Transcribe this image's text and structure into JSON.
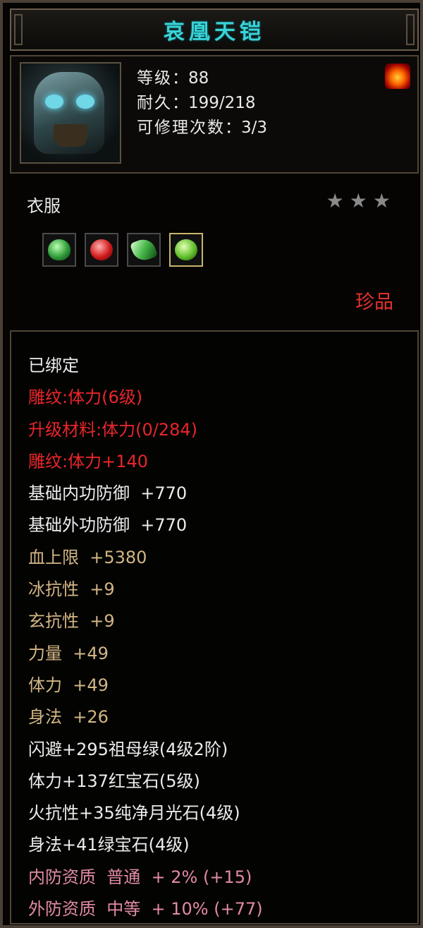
{
  "title": "哀凰天铠",
  "header": {
    "level_label": "等级",
    "level_value": "88",
    "durability_label": "耐久",
    "durability_value": "199/218",
    "repair_label": "可修理次数",
    "repair_value": "3/3",
    "sep": "：",
    "icons": {
      "item": "armor-helmet-icon",
      "element": "fire-icon"
    }
  },
  "item_type": "衣服",
  "stars": [
    "★",
    "★",
    "★"
  ],
  "gems": [
    {
      "name": "green-jade-gem",
      "color": "#2f9b38"
    },
    {
      "name": "ruby-gem",
      "color": "#d21a1a"
    },
    {
      "name": "emerald-gem",
      "color": "#48b84a"
    },
    {
      "name": "peridot-gem",
      "color": "#5fbf2a"
    }
  ],
  "rarity": "珍品",
  "attributes": [
    {
      "text": "已绑定",
      "color": "white"
    },
    {
      "text": "雕纹:体力(6级)",
      "color": "red"
    },
    {
      "text": "升级材料:体力(0/284)",
      "color": "red"
    },
    {
      "text": "雕纹:体力+140",
      "color": "red"
    },
    {
      "text": "基础内功防御  +770",
      "color": "white"
    },
    {
      "text": "基础外功防御  +770",
      "color": "white"
    },
    {
      "text": "血上限  +5380",
      "color": "gold"
    },
    {
      "text": "冰抗性  +9",
      "color": "gold"
    },
    {
      "text": "玄抗性  +9",
      "color": "gold"
    },
    {
      "text": "力量  +49",
      "color": "gold"
    },
    {
      "text": "体力  +49",
      "color": "gold"
    },
    {
      "text": "身法  +26",
      "color": "gold"
    },
    {
      "text": "闪避+295祖母绿(4级2阶)",
      "color": "white"
    },
    {
      "text": "体力+137红宝石(5级)",
      "color": "white"
    },
    {
      "text": "火抗性+35纯净月光石(4级)",
      "color": "white"
    },
    {
      "text": "身法+41绿宝石(4级)",
      "color": "white"
    },
    {
      "text": "内防资质  普通  + 2% (+15)",
      "color": "pink"
    },
    {
      "text": "外防资质  中等  + 10% (+77)",
      "color": "pink"
    }
  ]
}
